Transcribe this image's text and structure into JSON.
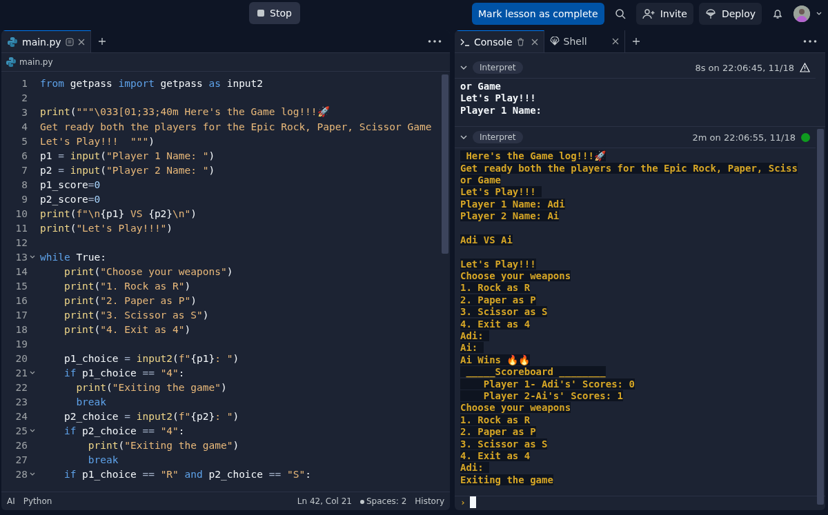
{
  "topbar": {
    "stop_label": "Stop",
    "complete_label": "Mark lesson as complete",
    "invite_label": "Invite",
    "deploy_label": "Deploy"
  },
  "editor": {
    "tabs": [
      {
        "label": "main.py",
        "selected": true
      }
    ],
    "breadcrumb": "main.py",
    "lines": [
      {
        "number": "1",
        "foldable": false,
        "tokens": [
          {
            "kind": "keyword",
            "text": "from"
          },
          {
            "kind": "plain",
            "text": " getpass "
          },
          {
            "kind": "keyword",
            "text": "import"
          },
          {
            "kind": "plain",
            "text": " getpass "
          },
          {
            "kind": "keyword",
            "text": "as"
          },
          {
            "kind": "plain",
            "text": " input2"
          }
        ]
      },
      {
        "number": "2",
        "foldable": false
      },
      {
        "number": "3",
        "foldable": false,
        "tokens": [
          {
            "kind": "call",
            "text": "print"
          },
          {
            "kind": "plain",
            "text": "("
          },
          {
            "kind": "string",
            "text": "\"\"\"\\033[01;33;40m Here's the Game log!!!🚀"
          }
        ]
      },
      {
        "number": "4",
        "foldable": false,
        "tokens": [
          {
            "kind": "string",
            "text": "Get ready both the players for the Epic Rock, Paper, Scissor Game"
          }
        ]
      },
      {
        "number": "5",
        "foldable": false,
        "tokens": [
          {
            "kind": "string",
            "text": "Let's Play!!!  \"\"\""
          },
          {
            "kind": "plain",
            "text": ")"
          }
        ]
      },
      {
        "number": "6",
        "foldable": false,
        "tokens": [
          {
            "kind": "plain",
            "text": "p1 "
          },
          {
            "kind": "operator",
            "text": "= "
          },
          {
            "kind": "call",
            "text": "input"
          },
          {
            "kind": "plain",
            "text": "("
          },
          {
            "kind": "string",
            "text": "\"Player 1 Name: \""
          },
          {
            "kind": "plain",
            "text": ")"
          }
        ]
      },
      {
        "number": "7",
        "foldable": false,
        "tokens": [
          {
            "kind": "plain",
            "text": "p2 "
          },
          {
            "kind": "operator",
            "text": "= "
          },
          {
            "kind": "call",
            "text": "input"
          },
          {
            "kind": "plain",
            "text": "("
          },
          {
            "kind": "string",
            "text": "\"Player 2 Name: \""
          },
          {
            "kind": "plain",
            "text": ")"
          }
        ]
      },
      {
        "number": "8",
        "foldable": false,
        "tokens": [
          {
            "kind": "plain",
            "text": "p1_score"
          },
          {
            "kind": "operator",
            "text": "="
          },
          {
            "kind": "number",
            "text": "0"
          }
        ]
      },
      {
        "number": "9",
        "foldable": false,
        "tokens": [
          {
            "kind": "plain",
            "text": "p2_score"
          },
          {
            "kind": "operator",
            "text": "="
          },
          {
            "kind": "number",
            "text": "0"
          }
        ]
      },
      {
        "number": "10",
        "foldable": false,
        "tokens": [
          {
            "kind": "call",
            "text": "print"
          },
          {
            "kind": "plain",
            "text": "("
          },
          {
            "kind": "string",
            "text": "f\"\\n"
          },
          {
            "kind": "plain",
            "text": "{p1}"
          },
          {
            "kind": "string",
            "text": " VS "
          },
          {
            "kind": "plain",
            "text": "{p2}"
          },
          {
            "kind": "string",
            "text": "\\n\""
          },
          {
            "kind": "plain",
            "text": ")"
          }
        ]
      },
      {
        "number": "11",
        "foldable": false,
        "tokens": [
          {
            "kind": "call",
            "text": "print"
          },
          {
            "kind": "plain",
            "text": "("
          },
          {
            "kind": "string",
            "text": "\"Let's Play!!!\""
          },
          {
            "kind": "plain",
            "text": ")"
          }
        ]
      },
      {
        "number": "12",
        "foldable": false
      },
      {
        "number": "13",
        "foldable": true,
        "tokens": [
          {
            "kind": "keyword",
            "text": "while"
          },
          {
            "kind": "plain",
            "text": " True:"
          }
        ]
      },
      {
        "number": "14",
        "foldable": false,
        "tokens": [
          {
            "kind": "call",
            "text": "    print"
          },
          {
            "kind": "plain",
            "text": "("
          },
          {
            "kind": "string",
            "text": "\"Choose your weapons\""
          },
          {
            "kind": "plain",
            "text": ")"
          }
        ]
      },
      {
        "number": "15",
        "foldable": false,
        "tokens": [
          {
            "kind": "call",
            "text": "    print"
          },
          {
            "kind": "plain",
            "text": "("
          },
          {
            "kind": "string",
            "text": "\"1. Rock as R\""
          },
          {
            "kind": "plain",
            "text": ")"
          }
        ]
      },
      {
        "number": "16",
        "foldable": false,
        "tokens": [
          {
            "kind": "call",
            "text": "    print"
          },
          {
            "kind": "plain",
            "text": "("
          },
          {
            "kind": "string",
            "text": "\"2. Paper as P\""
          },
          {
            "kind": "plain",
            "text": ")"
          }
        ]
      },
      {
        "number": "17",
        "foldable": false,
        "tokens": [
          {
            "kind": "call",
            "text": "    print"
          },
          {
            "kind": "plain",
            "text": "("
          },
          {
            "kind": "string",
            "text": "\"3. Scissor as S\""
          },
          {
            "kind": "plain",
            "text": ")"
          }
        ]
      },
      {
        "number": "18",
        "foldable": false,
        "tokens": [
          {
            "kind": "call",
            "text": "    print"
          },
          {
            "kind": "plain",
            "text": "("
          },
          {
            "kind": "string",
            "text": "\"4. Exit as 4\""
          },
          {
            "kind": "plain",
            "text": ")"
          }
        ]
      },
      {
        "number": "19",
        "foldable": false
      },
      {
        "number": "20",
        "foldable": false,
        "tokens": [
          {
            "kind": "plain",
            "text": "    p1_choice "
          },
          {
            "kind": "operator",
            "text": "= "
          },
          {
            "kind": "call",
            "text": "input2"
          },
          {
            "kind": "plain",
            "text": "("
          },
          {
            "kind": "string",
            "text": "f\""
          },
          {
            "kind": "plain",
            "text": "{p1}"
          },
          {
            "kind": "string",
            "text": ": \""
          },
          {
            "kind": "plain",
            "text": ")"
          }
        ]
      },
      {
        "number": "21",
        "foldable": true,
        "tokens": [
          {
            "kind": "keyword",
            "text": "    if"
          },
          {
            "kind": "plain",
            "text": " p1_choice "
          },
          {
            "kind": "operator",
            "text": "== "
          },
          {
            "kind": "string",
            "text": "\"4\""
          },
          {
            "kind": "plain",
            "text": ":"
          }
        ]
      },
      {
        "number": "22",
        "foldable": false,
        "tokens": [
          {
            "kind": "call",
            "text": "      print"
          },
          {
            "kind": "plain",
            "text": "("
          },
          {
            "kind": "string",
            "text": "\"Exiting the game\""
          },
          {
            "kind": "plain",
            "text": ")"
          }
        ]
      },
      {
        "number": "23",
        "foldable": false,
        "tokens": [
          {
            "kind": "keyword",
            "text": "      break"
          }
        ]
      },
      {
        "number": "24",
        "foldable": false,
        "tokens": [
          {
            "kind": "plain",
            "text": "    p2_choice "
          },
          {
            "kind": "operator",
            "text": "= "
          },
          {
            "kind": "call",
            "text": "input2"
          },
          {
            "kind": "plain",
            "text": "("
          },
          {
            "kind": "string",
            "text": "f\""
          },
          {
            "kind": "plain",
            "text": "{p2}"
          },
          {
            "kind": "string",
            "text": ": \""
          },
          {
            "kind": "plain",
            "text": ")"
          }
        ]
      },
      {
        "number": "25",
        "foldable": true,
        "tokens": [
          {
            "kind": "keyword",
            "text": "    if"
          },
          {
            "kind": "plain",
            "text": " p2_choice "
          },
          {
            "kind": "operator",
            "text": "== "
          },
          {
            "kind": "string",
            "text": "\"4\""
          },
          {
            "kind": "plain",
            "text": ":"
          }
        ]
      },
      {
        "number": "26",
        "foldable": false,
        "tokens": [
          {
            "kind": "call",
            "text": "        print"
          },
          {
            "kind": "plain",
            "text": "("
          },
          {
            "kind": "string",
            "text": "\"Exiting the game\""
          },
          {
            "kind": "plain",
            "text": ")"
          }
        ]
      },
      {
        "number": "27",
        "foldable": false,
        "tokens": [
          {
            "kind": "keyword",
            "text": "        break"
          }
        ]
      },
      {
        "number": "28",
        "foldable": true,
        "tokens": [
          {
            "kind": "keyword",
            "text": "    if"
          },
          {
            "kind": "plain",
            "text": " p1_choice "
          },
          {
            "kind": "operator",
            "text": "== "
          },
          {
            "kind": "string",
            "text": "\"R\""
          },
          {
            "kind": "keyword",
            "text": " and"
          },
          {
            "kind": "plain",
            "text": " p2_choice "
          },
          {
            "kind": "operator",
            "text": "== "
          },
          {
            "kind": "string",
            "text": "\"S\""
          },
          {
            "kind": "plain",
            "text": ":"
          }
        ]
      }
    ],
    "status_bar": {
      "ai_label": "AI",
      "language": "Python",
      "position": "Ln 42, Col 21",
      "spaces": "Spaces: 2",
      "history": "History"
    }
  },
  "console": {
    "tabs": [
      {
        "label": "Console",
        "kind": "console",
        "selected": true
      },
      {
        "label": "Shell",
        "kind": "shell",
        "selected": false
      }
    ],
    "runs": [
      {
        "label": "Interpret",
        "time": "8s on 22:06:45, 11/18",
        "kind": "warning",
        "highlighted": false,
        "output": [
          {
            "kind": "text",
            "text": "or Game"
          },
          {
            "kind": "text",
            "text": "Let's Play!!!"
          },
          {
            "kind": "text",
            "text": "Player 1 Name:"
          }
        ]
      },
      {
        "label": "Interpret",
        "time": "2m on 22:06:55, 11/18",
        "kind": "success",
        "highlighted": true,
        "output": [
          {
            "kind": "text",
            "text": " Here's the Game log!!!🚀"
          },
          {
            "kind": "text",
            "text": "Get ready both the players for the Epic Rock, Paper, Sciss"
          },
          {
            "kind": "text",
            "text": "or Game"
          },
          {
            "kind": "text",
            "text": "Let's Play!!! "
          },
          {
            "kind": "text",
            "text": "Player 1 Name: Adi"
          },
          {
            "kind": "text",
            "text": "Player 2 Name: Ai"
          },
          {
            "kind": "blank"
          },
          {
            "kind": "text",
            "text": "Adi VS Ai"
          },
          {
            "kind": "blank"
          },
          {
            "kind": "text",
            "text": "Let's Play!!!"
          },
          {
            "kind": "text",
            "text": "Choose your weapons"
          },
          {
            "kind": "text",
            "text": "1. Rock as R"
          },
          {
            "kind": "text",
            "text": "2. Paper as P"
          },
          {
            "kind": "text",
            "text": "3. Scissor as S"
          },
          {
            "kind": "text",
            "text": "4. Exit as 4"
          },
          {
            "kind": "text",
            "text": "Adi: "
          },
          {
            "kind": "text",
            "text": "Ai: "
          },
          {
            "kind": "text",
            "text": "Ai Wins 🔥🔥"
          },
          {
            "kind": "text",
            "text": " _____Scoreboard ________"
          },
          {
            "kind": "text",
            "text": "    Player 1- Adi's' Scores: 0"
          },
          {
            "kind": "text",
            "text": "    Player 2-Ai's' Scores: 1"
          },
          {
            "kind": "text",
            "text": "Choose your weapons"
          },
          {
            "kind": "text",
            "text": "1. Rock as R"
          },
          {
            "kind": "text",
            "text": "2. Paper as P"
          },
          {
            "kind": "text",
            "text": "3. Scissor as S"
          },
          {
            "kind": "text",
            "text": "4. Exit as 4"
          },
          {
            "kind": "text",
            "text": "Adi: "
          },
          {
            "kind": "text",
            "text": "Exiting the game"
          }
        ]
      }
    ],
    "prompt": "›"
  }
}
